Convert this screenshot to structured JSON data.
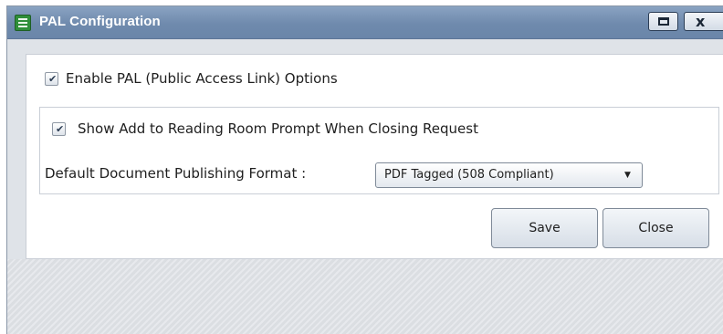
{
  "window": {
    "title": "PAL Configuration",
    "app_icon": "list-document-icon",
    "maximize_icon": "maximize-icon",
    "close_icon": "close-icon",
    "close_glyph": "x"
  },
  "options": {
    "enable_pal": {
      "label": "Enable PAL (Public Access Link) Options",
      "checked": true
    },
    "show_reading_room_prompt": {
      "label": "Show Add to Reading Room Prompt When Closing Request",
      "checked": true
    },
    "default_format": {
      "label": "Default Document Publishing Format :",
      "selected": "PDF Tagged (508 Compliant)"
    }
  },
  "actions": {
    "save_label": "Save",
    "close_label": "Close"
  },
  "colors": {
    "titlebar": "#7891b3",
    "panel": "#ffffff",
    "background": "#dfe3e8"
  },
  "glyphs": {
    "check": "✔",
    "dropdown_arrow": "▼"
  }
}
